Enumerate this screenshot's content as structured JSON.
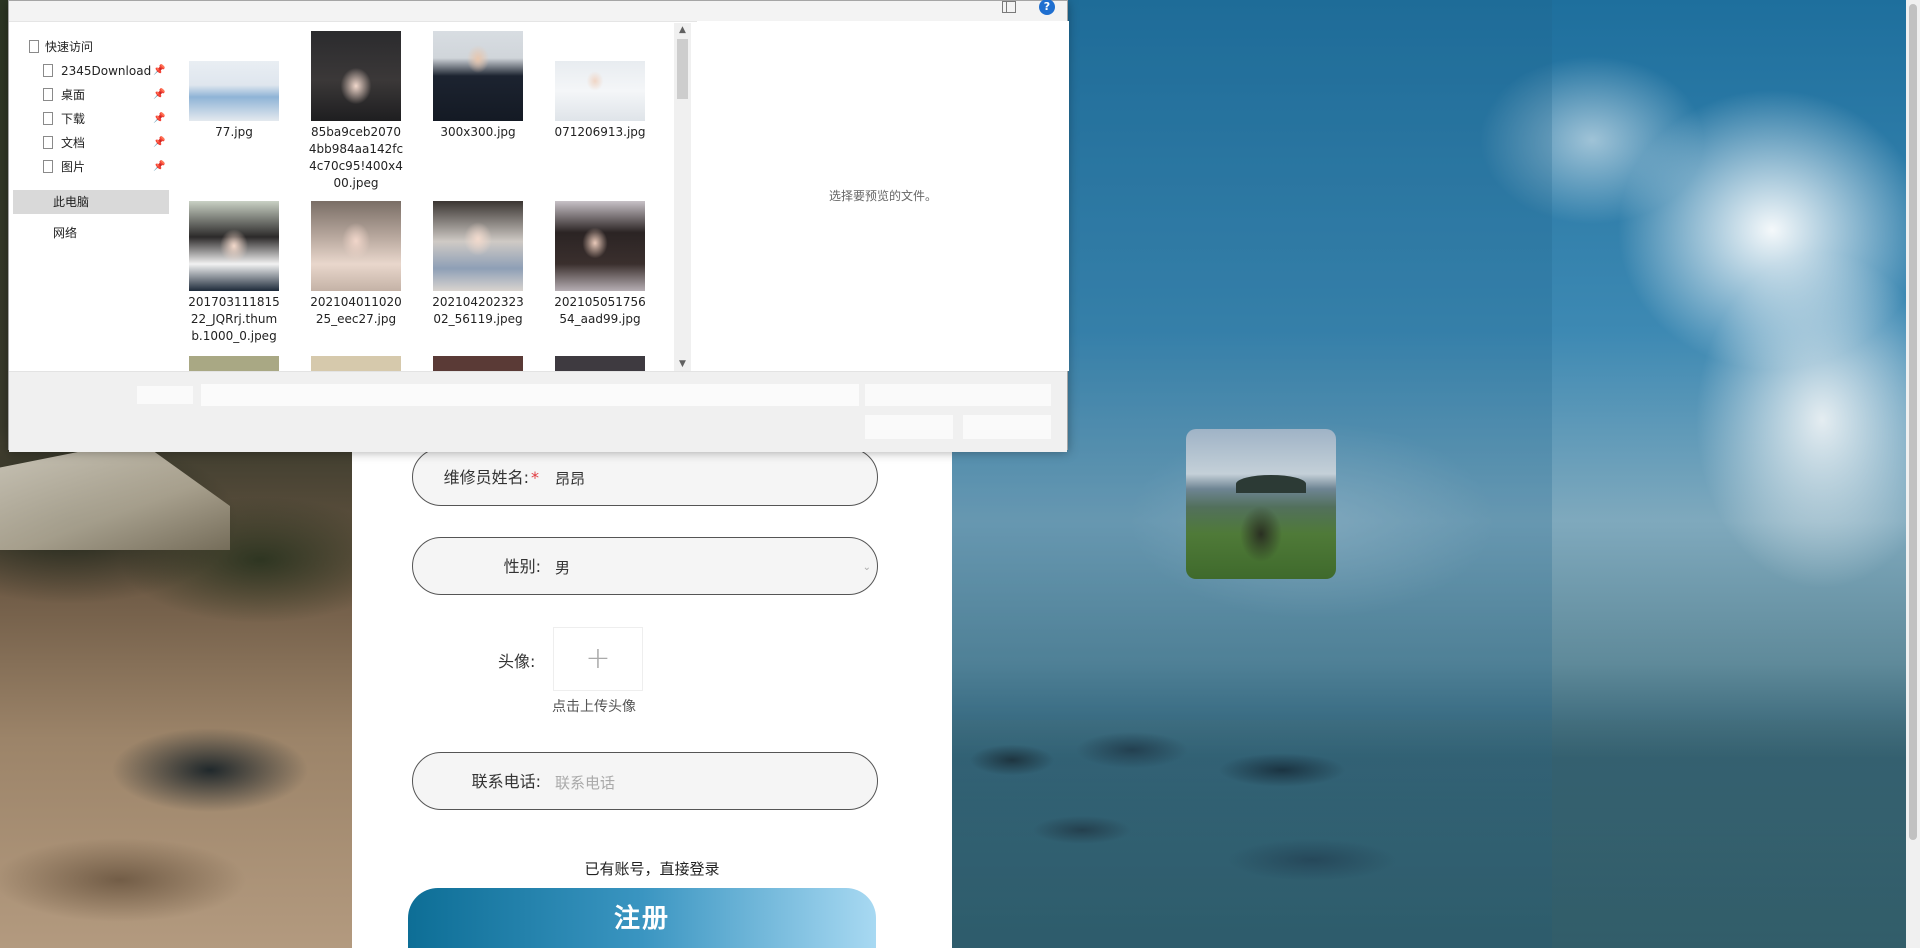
{
  "dialog": {
    "help_glyph": "?",
    "nav": [
      {
        "label": "快速访问",
        "pinned": false
      },
      {
        "label": "2345Download",
        "pinned": true
      },
      {
        "label": "桌面",
        "pinned": true
      },
      {
        "label": "下载",
        "pinned": true
      },
      {
        "label": "文档",
        "pinned": true
      },
      {
        "label": "图片",
        "pinned": true
      },
      {
        "label": "此电脑",
        "pinned": false
      },
      {
        "label": "网络",
        "pinned": false
      }
    ],
    "pin_glyph": "📌",
    "files": [
      {
        "name": "77.jpg"
      },
      {
        "name": "85ba9ceb20704bb984aa142fc4c70c95!400x400.jpeg"
      },
      {
        "name": "300x300.jpg"
      },
      {
        "name": "071206913.jpg"
      },
      {
        "name": "20170311181522_JQRrj.thumb.1000_0.jpeg"
      },
      {
        "name": "20210401102025_eec27.jpg"
      },
      {
        "name": "20210420232302_56119.jpeg"
      },
      {
        "name": "20210505175654_aad99.jpg"
      }
    ],
    "preview_message": "选择要预览的文件。",
    "scroll_up": "▲",
    "scroll_down": "▼"
  },
  "form": {
    "name_label": "维修员姓名:",
    "required_mark": "*",
    "name_value": "昂昂",
    "gender_label": "性别:",
    "gender_value": "男",
    "gender_chevron": "⌄",
    "avatar_label": "头像:",
    "upload_plus": "+",
    "upload_hint": "点击上传头像",
    "phone_label": "联系电话:",
    "phone_placeholder": "联系电话",
    "login_link": "已有账号，直接登录",
    "register_button": "注册"
  }
}
